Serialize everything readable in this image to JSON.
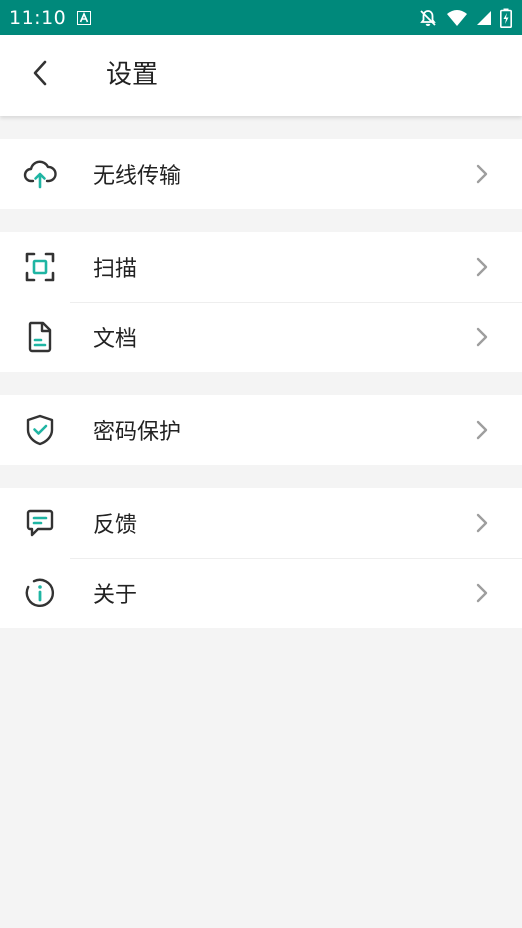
{
  "status_bar": {
    "time": "11:10",
    "notification_icon": "a-font-icon",
    "icons": [
      "bell-off-icon",
      "wifi-icon",
      "signal-icon",
      "battery-charging-icon"
    ],
    "color": "#00897b"
  },
  "app_bar": {
    "back_icon": "chevron-left-icon",
    "title": "设置"
  },
  "settings": {
    "groups": [
      {
        "items": [
          {
            "label": "无线传输",
            "icon": "cloud-upload-icon"
          }
        ]
      },
      {
        "items": [
          {
            "label": "扫描",
            "icon": "scan-icon"
          },
          {
            "label": "文档",
            "icon": "document-icon"
          }
        ]
      },
      {
        "items": [
          {
            "label": "密码保护",
            "icon": "shield-check-icon"
          }
        ]
      },
      {
        "items": [
          {
            "label": "反馈",
            "icon": "feedback-icon"
          },
          {
            "label": "关于",
            "icon": "info-icon"
          }
        ]
      }
    ]
  },
  "colors": {
    "accent": "#1fb5a3",
    "icon_dark": "#333333",
    "chevron": "#9e9e9e",
    "background": "#f4f4f4"
  }
}
